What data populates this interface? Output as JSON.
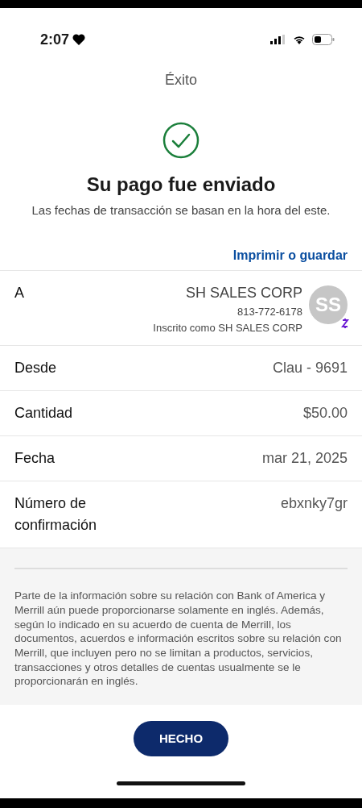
{
  "status_bar": {
    "time": "2:07"
  },
  "header": {
    "title": "Éxito"
  },
  "result": {
    "heading": "Su pago fue enviado",
    "subtitle": "Las fechas de transacción se basan en la hora del este."
  },
  "print_link": "Imprimir o guardar",
  "details": [
    {
      "kind": "recipient",
      "label": "A",
      "name": "SH SALES CORP",
      "phone": "813-772-6178",
      "enrolled": "Inscrito como SH SALES CORP",
      "avatar": "SS"
    },
    {
      "kind": "simple",
      "label": "Desde",
      "value": "Clau - 9691"
    },
    {
      "kind": "simple",
      "label": "Cantidad",
      "value": "$50.00"
    },
    {
      "kind": "simple",
      "label": "Fecha",
      "value": "mar 21, 2025"
    },
    {
      "kind": "simple",
      "label": "Número de confirmación",
      "value": "ebxnky7gr"
    }
  ],
  "disclaimer": "Parte de la información sobre su relación con Bank of America y Merrill aún puede proporcionarse solamente en inglés. Además, según lo indicado en su acuerdo de cuenta de Merrill, los documentos, acuerdos e información escritos sobre su relación con Merrill, que incluyen pero no se limitan a productos, servicios, transacciones y otros detalles de cuentas usualmente se le proporcionarán en inglés.",
  "done_button": "HECHO"
}
